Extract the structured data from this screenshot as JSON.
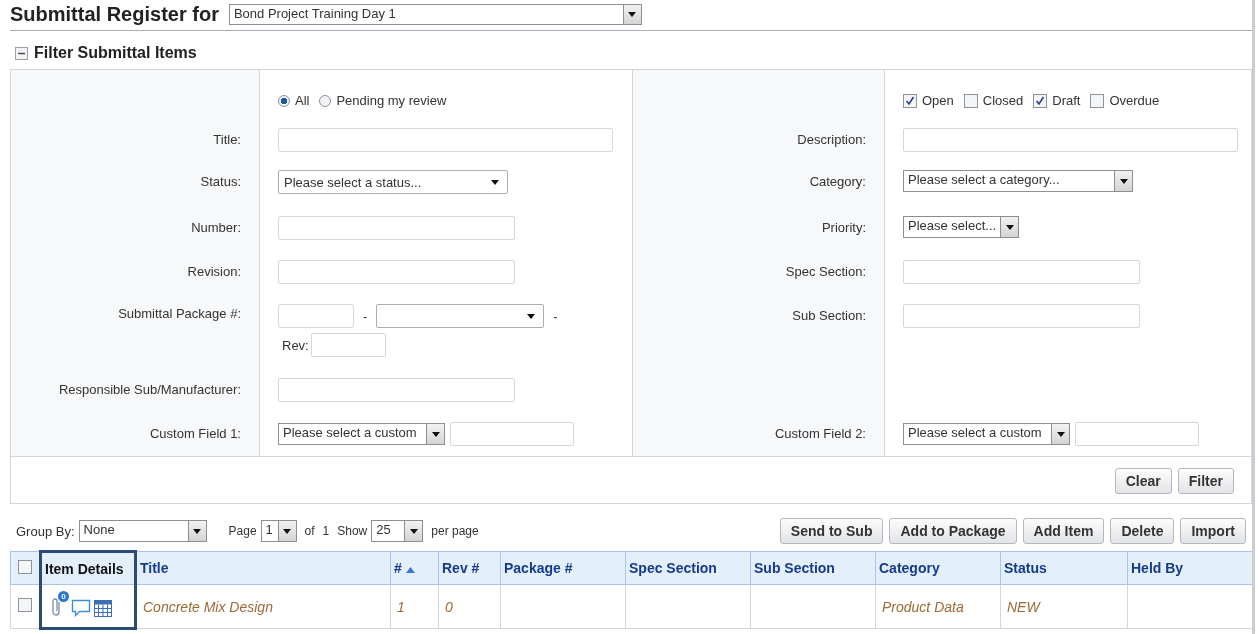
{
  "header": {
    "title": "Submittal Register for",
    "project": "Bond Project Training Day 1"
  },
  "filter": {
    "title": "Filter Submittal Items",
    "expanded": true,
    "scope": [
      {
        "label": "All",
        "selected": true
      },
      {
        "label": "Pending my review",
        "selected": false
      }
    ],
    "statuses": [
      {
        "label": "Open",
        "checked": true
      },
      {
        "label": "Closed",
        "checked": false
      },
      {
        "label": "Draft",
        "checked": true
      },
      {
        "label": "Overdue",
        "checked": false
      }
    ],
    "rows": [
      {
        "left": {
          "label": "Title:",
          "kind": "text",
          "wide": true
        },
        "right": {
          "label": "Description:",
          "kind": "text",
          "wide": true
        }
      },
      {
        "left": {
          "label": "Status:",
          "kind": "select",
          "value": "Please select a status..."
        },
        "right": {
          "label": "Category:",
          "kind": "combo",
          "wide": true,
          "value": "Please select a category..."
        }
      },
      {
        "left": {
          "label": "Number:",
          "kind": "text",
          "wide": false
        },
        "right": {
          "label": "Priority:",
          "kind": "combo",
          "wide": false,
          "value": "Please select..."
        }
      },
      {
        "left": {
          "label": "Revision:",
          "kind": "text",
          "wide": false
        },
        "right": {
          "label": "Spec Section:",
          "kind": "text",
          "wide": false
        }
      },
      {
        "left": {
          "label": "Submittal Package #:",
          "kind": "package",
          "separators": [
            "-",
            "-"
          ],
          "rev_label": "Rev:"
        },
        "right": {
          "label": "Sub Section:",
          "kind": "text",
          "wide": false
        }
      },
      {
        "left": {
          "label": "Responsible Sub/Manufacturer:",
          "kind": "text",
          "wide": false
        }
      },
      {
        "left": {
          "label": "Custom Field 1:",
          "kind": "custom",
          "value": "Please select a custom"
        },
        "right": {
          "label": "Custom Field 2:",
          "kind": "custom",
          "value": "Please select a custom"
        }
      }
    ],
    "buttons": [
      "Clear",
      "Filter"
    ]
  },
  "toolbar": {
    "group_label": "Group By:",
    "group_value": "None",
    "page_label": "Page",
    "page_value": "1",
    "of_label": "of",
    "page_count": "1",
    "show_label": "Show",
    "show_value": "25",
    "per_page_label": "per page",
    "buttons": [
      "Send to Sub",
      "Add to Package",
      "Add Item",
      "Delete",
      "Import"
    ]
  },
  "table": {
    "header_checked": false,
    "columns": [
      {
        "label": "Item Details",
        "highlighted": true
      },
      {
        "label": "Title"
      },
      {
        "label": "#",
        "sort_ascending": true
      },
      {
        "label": "Rev #"
      },
      {
        "label": "Package #"
      },
      {
        "label": "Spec Section"
      },
      {
        "label": "Sub Section"
      },
      {
        "label": "Category"
      },
      {
        "label": "Status"
      },
      {
        "label": "Held By"
      }
    ],
    "rows": [
      {
        "checked": false,
        "attachment_count": "0",
        "title": "Concrete Mix Design",
        "number": "1",
        "rev": "0",
        "category": "Product Data",
        "status": "NEW"
      }
    ]
  }
}
